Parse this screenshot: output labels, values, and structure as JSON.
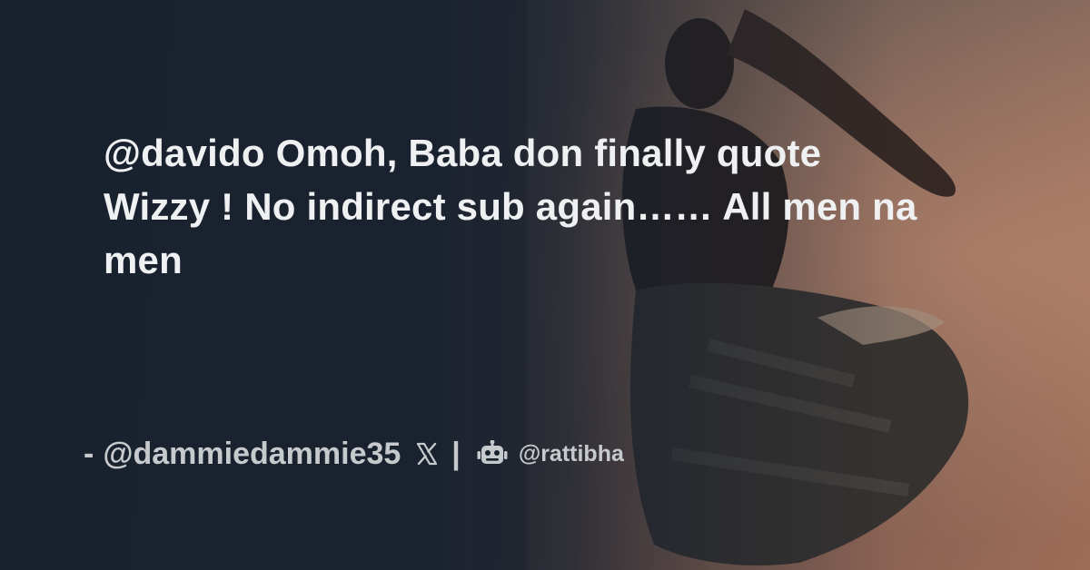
{
  "tweet": {
    "text": "@davido Omoh, Baba don finally quote Wizzy ! No indirect sub again…… All men na men"
  },
  "attribution": {
    "dash": "-",
    "author": "@dammiedammie35",
    "platform_icon": "x-logo-icon",
    "separator": "|",
    "bot_icon": "robot-icon",
    "site_handle": "@rattibha"
  },
  "colors": {
    "background": "#18212e",
    "headline": "#eef0f2",
    "attribution": "#c7cacd"
  }
}
